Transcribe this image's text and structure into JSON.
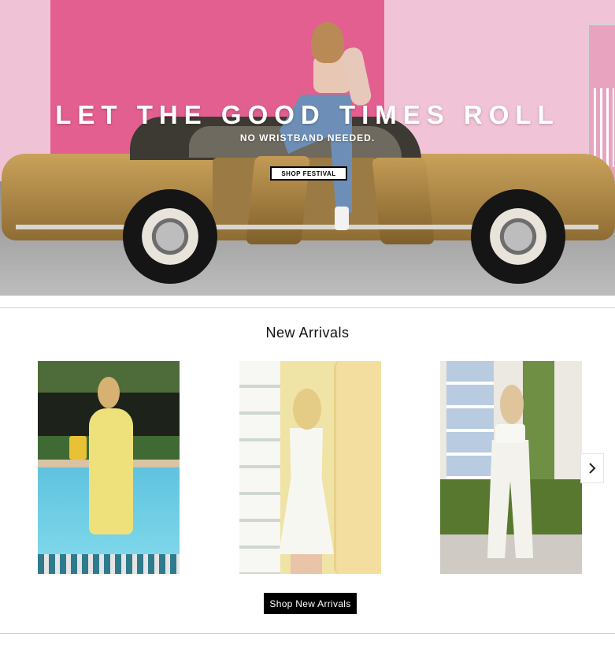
{
  "hero": {
    "title": "LET THE GOOD TIMES ROLL",
    "subtitle": "NO WRISTBAND NEEDED.",
    "button_label": "SHOP FESTIVAL"
  },
  "new_arrivals": {
    "title": "New Arrivals",
    "products": [
      {
        "name": "product-yellow-slip-dress"
      },
      {
        "name": "product-white-lace-up-dress"
      },
      {
        "name": "product-white-crop-top-pants-set"
      }
    ],
    "next_icon": "chevron-right-icon",
    "button_label": "Shop New Arrivals"
  },
  "colors": {
    "hero_pink": "#e35f8f",
    "button_black": "#000000",
    "divider": "#cfcfcf"
  }
}
